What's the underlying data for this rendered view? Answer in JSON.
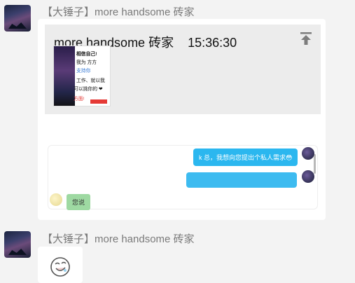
{
  "messages": [
    {
      "sender": "【大锤子】more handsome 砖家",
      "card": {
        "title": "more handsome 砖家",
        "time": "15:36:30",
        "pin_icon": "pin-to-top-icon",
        "poster_lines": [
          "相信自己!",
          "我为 方方",
          "支持你",
          "工作、就以我",
          "可以挑你的 ❤",
          "方面!"
        ],
        "chat": {
          "bubble_1": "k 总，我想向您提出个私人需求😳",
          "bubble_3": "您说"
        }
      }
    },
    {
      "sender": "【大锤子】more handsome 砖家",
      "sticker_icon": "emoji-face-icon"
    }
  ],
  "colors": {
    "bubble_blue": "#2bb7ef",
    "bubble_green": "#9ed9a2",
    "background": "#f3f3f3"
  }
}
